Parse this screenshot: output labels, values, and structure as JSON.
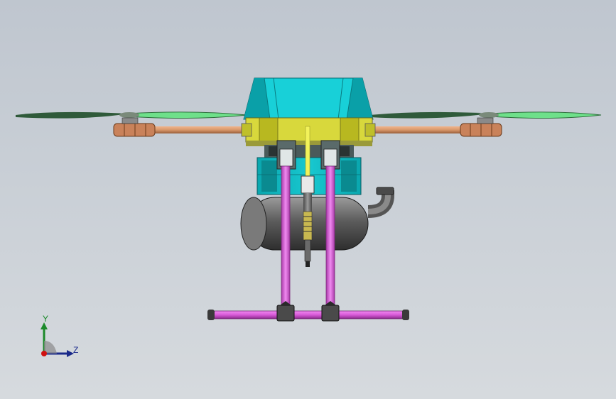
{
  "view": {
    "background_top": "#bfc6cf",
    "background_bottom": "#d6dade"
  },
  "model": {
    "name": "quadcopter-sprayer-drone",
    "colors": {
      "canopy": "#00c8d0",
      "canopy_dark": "#009aa5",
      "body_yellow": "#d6d63a",
      "arm_copper": "#d8976a",
      "propeller_green": "#5fd67a",
      "propeller_dark": "#2f6f3d",
      "leg_magenta": "#d85ad8",
      "tank_gray": "#6a6a6a",
      "frame_dark": "#3a3a3a"
    }
  },
  "triad": {
    "y_label": "Y",
    "z_label": "Z",
    "y_color": "#1c8a2a",
    "z_color": "#1a2a8a",
    "origin_color": "#d01010"
  }
}
